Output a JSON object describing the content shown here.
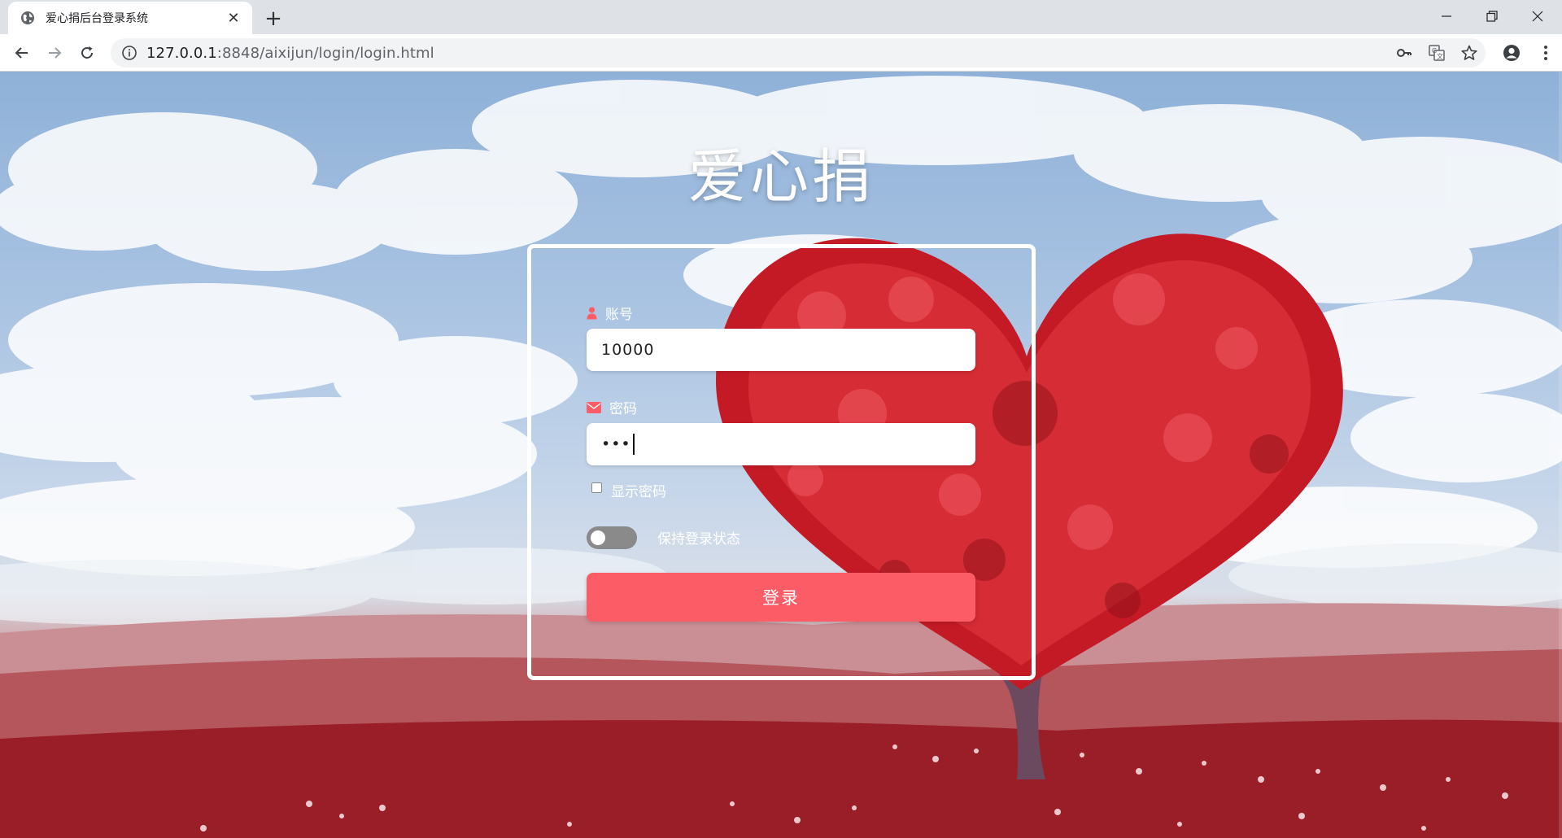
{
  "browser": {
    "tab": {
      "title": "爱心捐后台登录系统",
      "close_glyph": "✕",
      "favicon": "globe-icon"
    },
    "new_tab_glyph": "+",
    "window_controls": [
      "minimize-icon",
      "restore-icon",
      "close-icon"
    ],
    "url_host": "127.0.0.1",
    "url_rest": ":8848/aixijun/login/login.html",
    "omnibox_icons": [
      "key-icon",
      "translate-icon",
      "star-icon"
    ],
    "toolbar_icons": [
      "profile-icon",
      "menu-icon"
    ]
  },
  "page": {
    "title": "爱心捐",
    "form": {
      "account_label": "账号",
      "account_value": "10000",
      "password_label": "密码",
      "password_value": "•••",
      "show_password_label": "显示密码",
      "show_password_checked": false,
      "remember_label": "保持登录状态",
      "remember_on": false,
      "submit_label": "登录"
    }
  },
  "colors": {
    "accent": "#fc5c65",
    "tabbar": "#dee1e6",
    "toggle_off": "#8a8a8a"
  }
}
